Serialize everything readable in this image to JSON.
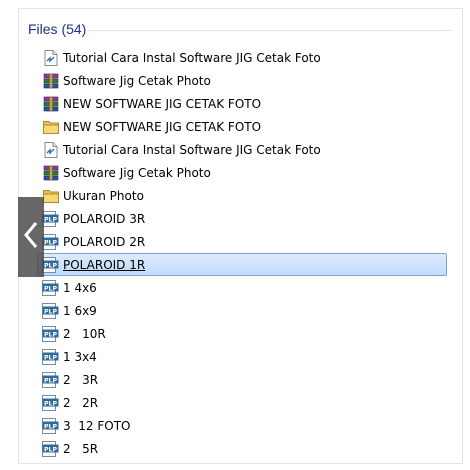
{
  "header": {
    "title": "Files (54)"
  },
  "items": [
    {
      "label": "Tutorial Cara Instal Software JIG Cetak Foto",
      "icon": "text-document-icon"
    },
    {
      "label": "Software Jig Cetak Photo",
      "icon": "winrar-archive-icon"
    },
    {
      "label": "NEW SOFTWARE JIG CETAK FOTO",
      "icon": "winrar-archive-icon"
    },
    {
      "label": "NEW SOFTWARE JIG CETAK FOTO",
      "icon": "folder-icon"
    },
    {
      "label": "Tutorial Cara Instal Software JIG Cetak Foto",
      "icon": "text-document-icon"
    },
    {
      "label": "Software Jig Cetak Photo",
      "icon": "winrar-archive-icon"
    },
    {
      "label": "Ukuran Photo",
      "icon": "folder-icon"
    },
    {
      "label": "POLAROID 3R",
      "icon": "plp-file-icon"
    },
    {
      "label": "POLAROID 2R",
      "icon": "plp-file-icon"
    },
    {
      "label": "POLAROID 1R",
      "icon": "plp-file-icon",
      "selected": true
    },
    {
      "label": "1 4x6",
      "icon": "plp-file-icon"
    },
    {
      "label": "1 6x9",
      "icon": "plp-file-icon"
    },
    {
      "label": "2   10R",
      "icon": "plp-file-icon"
    },
    {
      "label": "1 3x4",
      "icon": "plp-file-icon"
    },
    {
      "label": "2   3R",
      "icon": "plp-file-icon"
    },
    {
      "label": "2   2R",
      "icon": "plp-file-icon"
    },
    {
      "label": "3  12 FOTO",
      "icon": "plp-file-icon"
    },
    {
      "label": "2   5R",
      "icon": "plp-file-icon"
    }
  ],
  "nav": {
    "back_icon": "chevron-left-icon"
  },
  "colors": {
    "header_text": "#1e3287",
    "selection": "#c9dffc",
    "selection_border": "#7da2ce"
  }
}
